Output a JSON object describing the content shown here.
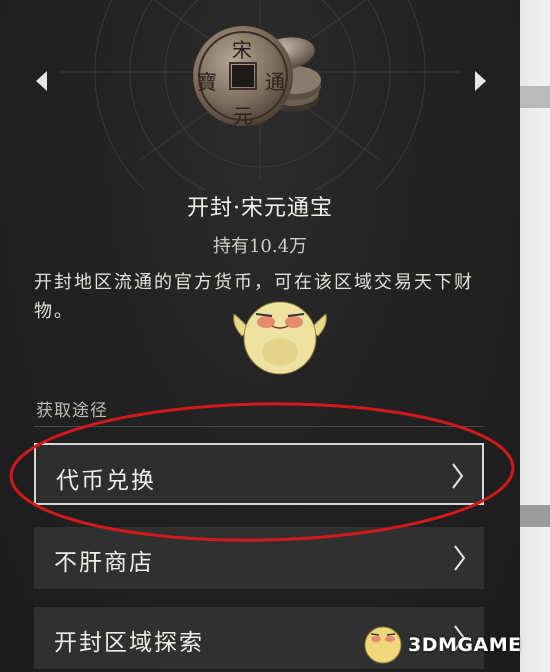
{
  "item": {
    "title": "开封·宋元通宝",
    "holding": "持有10.4万",
    "description": "开封地区流通的官方货币，可在该区域交易天下财物。",
    "coin_characters": [
      "宋",
      "通",
      "元",
      "寶"
    ]
  },
  "nav": {
    "prev_icon": "arrow-left-icon",
    "next_icon": "arrow-right-icon"
  },
  "acquire": {
    "section_label": "获取途径",
    "options": [
      {
        "label": "代币兑换"
      },
      {
        "label": "不肝商店"
      },
      {
        "label": "开封区域探索"
      }
    ]
  },
  "watermark": {
    "text": "3DMGAME"
  },
  "colors": {
    "background": "#1f1f1f",
    "button": "#303030",
    "button_selected_border": "#d7d7d7",
    "annotation_red": "#d3191c",
    "coin": "#8a7a6a"
  }
}
